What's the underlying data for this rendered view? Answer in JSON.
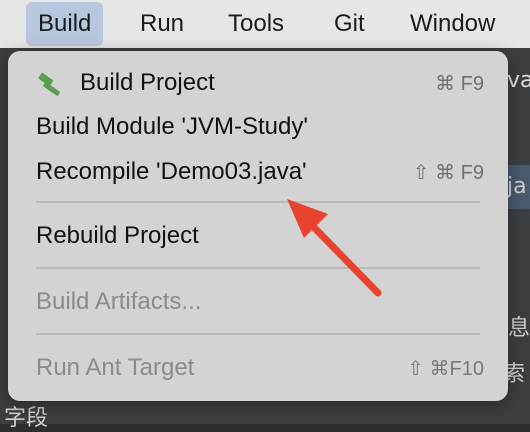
{
  "menubar": {
    "items": [
      "Build",
      "Run",
      "Tools",
      "Git",
      "Window"
    ]
  },
  "background": {
    "fragments": [
      "va",
      "ja",
      "息",
      "字段",
      "属性 含索"
    ]
  },
  "dropdown": {
    "items": [
      {
        "label": "Build Project",
        "shortcut": "⌘ F9",
        "disabled": false,
        "icon": "hammer-icon"
      },
      {
        "label": "Build Module 'JVM-Study'",
        "shortcut": "",
        "disabled": false
      },
      {
        "label": "Recompile 'Demo03.java'",
        "shortcut": "⇧ ⌘ F9",
        "disabled": false
      },
      {
        "label": "Rebuild Project",
        "shortcut": "",
        "disabled": false
      },
      {
        "label": "Build Artifacts...",
        "shortcut": "",
        "disabled": true
      },
      {
        "label": "Run Ant Target",
        "shortcut": "⇧ ⌘F10",
        "disabled": true
      }
    ]
  },
  "colors": {
    "menubar_bg": "#e6e6e6",
    "active_menu_bg": "#b7c7df",
    "dropdown_bg": "#d3d3d3",
    "annotation_arrow": "#e8432f",
    "hammer": "#5a9e52"
  }
}
